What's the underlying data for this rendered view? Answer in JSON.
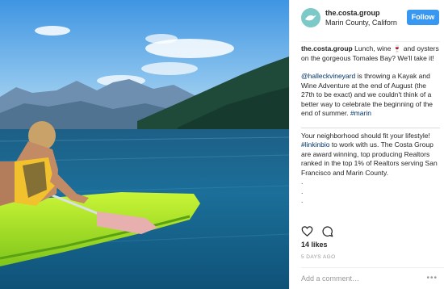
{
  "post": {
    "username": "the.costa.group",
    "location": "Marin County, Californ",
    "follow_label": "Follow",
    "caption": {
      "username": "the.costa.group",
      "p1_text": " Lunch, wine 🍷 and oysters on the gorgeous Tomales Bay? We'll take it!",
      "p2_mention": "@halleckvineyard",
      "p2_text": " is throwing a Kayak and Wine Adventure at the end of August (the 27th to be exact) and we couldn't think of a better way to celebrate the beginning of the end of summer. ",
      "p2_hashtag": "#marin",
      "p3_text_a": "Your neighborhood should fit your lifestyle! ",
      "p3_hashtag": "#linkinbio",
      "p3_text_b": " to work with us. The Costa Group are award winning, top producing Realtors ranked in the top 1% of Realtors serving San Francisco and Marin County.",
      "dots": [
        ".",
        ".",
        "."
      ]
    },
    "likes": "14 likes",
    "age": "5 DAYS AGO",
    "comment_placeholder": "Add a comment…",
    "more_label": "•••",
    "icons": {
      "like": "heart-icon",
      "comment": "comment-icon",
      "more": "more-options-icon",
      "avatar": "bird-logo"
    },
    "colors": {
      "follow_button": "#3897f0",
      "link": "#003569",
      "avatar_bg": "#7cc9c8"
    }
  }
}
